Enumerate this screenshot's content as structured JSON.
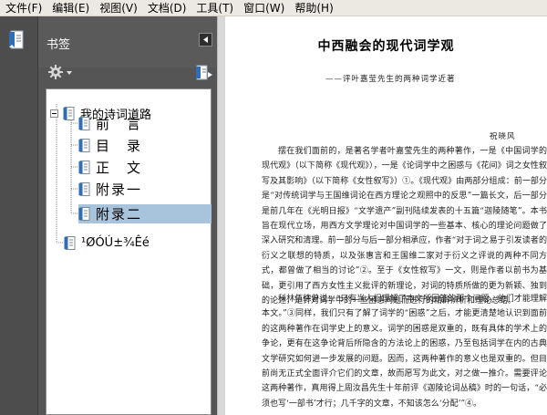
{
  "menu": {
    "items": [
      "文件(F)",
      "编辑(E)",
      "视图(V)",
      "文档(D)",
      "工具(T)",
      "窗口(W)",
      "帮助(H)"
    ]
  },
  "panel": {
    "title": "书签",
    "icons": {
      "strip": "bookmark-panel-icon",
      "options": "gear-options-icon",
      "expand": "expand-bookmark-icon",
      "collapse": "triangle-left-icon"
    }
  },
  "bookmarks": {
    "root": "我的诗词道路",
    "children": [
      "前　言",
      "目　录",
      "正　文",
      "附录一",
      "附录二"
    ],
    "selected_index": 4,
    "other": "¹ØÓÚ±¾Êé"
  },
  "document": {
    "title": "中西融会的现代词学观",
    "subtitle": "——评叶嘉莹先生的两种词学近著",
    "author": "祝晓风",
    "para1": "摆在我们面前的，是著名学者叶嘉莹先生的两种著作，一是《中国词学的现代观》（以下简称《现代观》），一是《论词学中之困惑与《花间》词之女性叙写及其影响》（以下简称《女性叙写》）①。《现代观》由两部分组成：前一部分是“对传统词学与王国维词论在西方理论之观照中的反思”一篇长文，后一部分是前几年在《光明日报》“文学遗产”副刊陆续发表的十五篇“迦陵随笔”。本书旨在现代立场，用西方文学理论对中国词学的一些基本、核心的理论问题做了深入研究和清理。前一部分与后一部分相承应，作者“对于词之易于引发读者的衍义之联想的特质，以及张惠言和王国维二家对于衍义之评说的两种不同方式，都曾做了相当的讨论”②。至于《女性叙写》一文，则是作者以前书为基础，更引用了西方女性主义批评的新理论，对词的特质所做的更为新颖、独到的论述，是针对词学中的一些困惑问题而进行的精辟辨析和理论总结。",
    "para2": "科林伍德曾说：“只有当人们理解了本文所回答的那个问题，他们才能理解本文。”③同样，我们只有了解了词学的“困惑”之后，才能更清楚地认识到面前的这两种著作在词学史上的意义。词学的困惑是双重的，既有具体的学术上的争论，更有在这争论背后所隐含的方法论上的困惑，乃至包括词学在内的古典文学研究如何进一步发展的问题。因而，这两种著作的意义也是双重的。但目前尚无正式全面评介它们的文章，故而愿写为此文，对之做一推介。需要评论这两种著作，真用得上周汝昌先生十年前评《迦陵论词丛稿》时的一句话，“必须也写‘一部书’才行；几千字的文章，不知该怎么‘分配’”④。"
  }
}
